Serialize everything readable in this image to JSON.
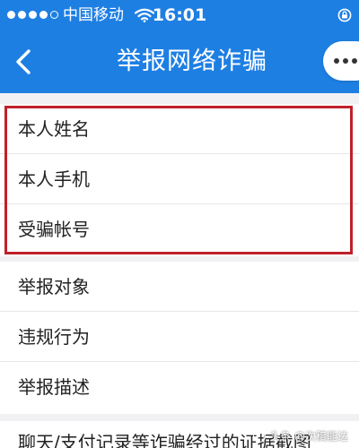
{
  "status_bar": {
    "carrier": "中国移动",
    "time": "16:01",
    "signal_filled": 4,
    "signal_total": 5
  },
  "nav": {
    "title": "举报网络诈骗",
    "back_icon": "chevron-left-icon",
    "more_icon": "more-dots-icon"
  },
  "form": {
    "highlighted_group": [
      {
        "label": "本人姓名"
      },
      {
        "label": "本人手机"
      },
      {
        "label": "受骗帐号"
      }
    ],
    "report_group": [
      {
        "label": "举报对象"
      },
      {
        "label": "违规行为"
      },
      {
        "label": "举报描述"
      }
    ],
    "evidence_label": "聊天/支付记录等诈骗经过的证据截图"
  },
  "watermark": {
    "text": "头条 @次稿能达"
  },
  "colors": {
    "header_blue": "#1e7fe3",
    "highlight_red": "#c0202a",
    "background": "#f1f1f3"
  }
}
